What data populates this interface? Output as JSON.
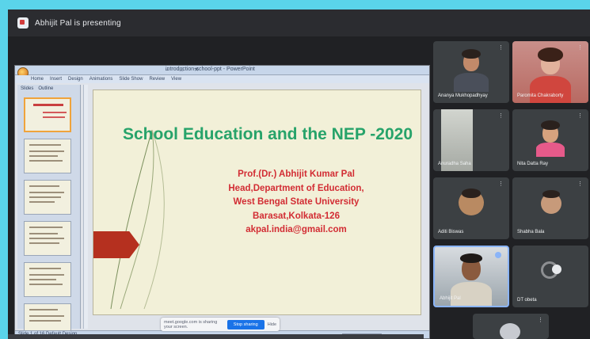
{
  "meeting": {
    "presenter_label": "Abhijit Pal is presenting",
    "presenting_icon": "present-icon"
  },
  "shared_screen": {
    "app_title": "introduction-school-ppt - PowerPoint",
    "menu_items": [
      "Home",
      "Insert",
      "Design",
      "Animations",
      "Slide Show",
      "Review",
      "View"
    ],
    "panel_tabs": [
      "Slides",
      "Outline"
    ],
    "status_text": "Slide 1 of 16   Default Design",
    "slide": {
      "title": "School Education and the NEP -2020",
      "lines": [
        "Prof.(Dr.) Abhijit  Kumar Pal",
        "Head,Department of Education,",
        "West Bengal State University",
        "Barasat,Kolkata-126",
        "akpal.india@gmail.com"
      ],
      "accent_color": "#b5301f",
      "title_color": "#27a36a",
      "text_color": "#d22c33"
    }
  },
  "share_bar": {
    "message": "meet.google.com is sharing your screen.",
    "stop_label": "Stop sharing",
    "hide_label": "Hide"
  },
  "participants": [
    {
      "name": "Ananya Mukhopadhyay",
      "tile": 1
    },
    {
      "name": "Paromita Chakraborty",
      "tile": 2
    },
    {
      "name": "Anuradha Saha",
      "tile": 3
    },
    {
      "name": "Nita Datta Ray",
      "tile": 4
    },
    {
      "name": "Aditi Biswas",
      "tile": 5
    },
    {
      "name": "Shabha Bala",
      "tile": 6
    },
    {
      "name": "Abhijit Pal",
      "tile": 7
    },
    {
      "name": "DT obeta",
      "tile": 8
    }
  ]
}
